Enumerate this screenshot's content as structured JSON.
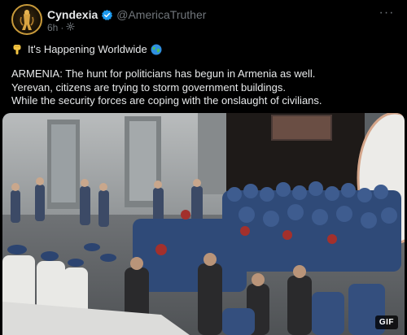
{
  "post": {
    "author": {
      "display_name": "Cyndexia",
      "handle": "@AmericaTruther",
      "verified_icon": "verified-badge-icon"
    },
    "timestamp": "6h",
    "more_label": "···",
    "headline": "It's Happening Worldwide",
    "body_lines": [
      "ARMENIA: The hunt for politicians has begun in Armenia as well.",
      "Yerevan, citizens are trying to storm government buildings.",
      "While the security forces are coping with the onslaught of civilians."
    ],
    "media": {
      "badge": "GIF"
    }
  },
  "colors": {
    "background": "#000000",
    "text": "#e7e9ea",
    "muted": "#71767b",
    "verified": "#1d9bf0"
  }
}
